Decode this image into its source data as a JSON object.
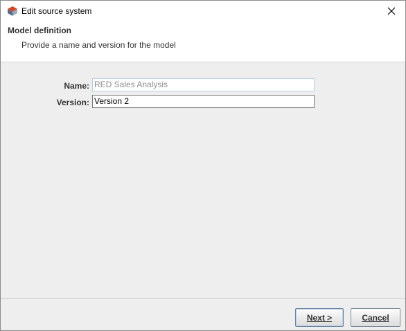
{
  "window": {
    "title": "Edit source system",
    "close_icon": "close-icon",
    "app_icon": "app-icon"
  },
  "header": {
    "title": "Model definition",
    "description": "Provide a name and version for the model"
  },
  "form": {
    "name_label": "Name:",
    "name_value": "RED Sales Analysis",
    "version_label": "Version:",
    "version_value": "Version 2"
  },
  "footer": {
    "next_label": "Next >",
    "cancel_label": "Cancel"
  }
}
